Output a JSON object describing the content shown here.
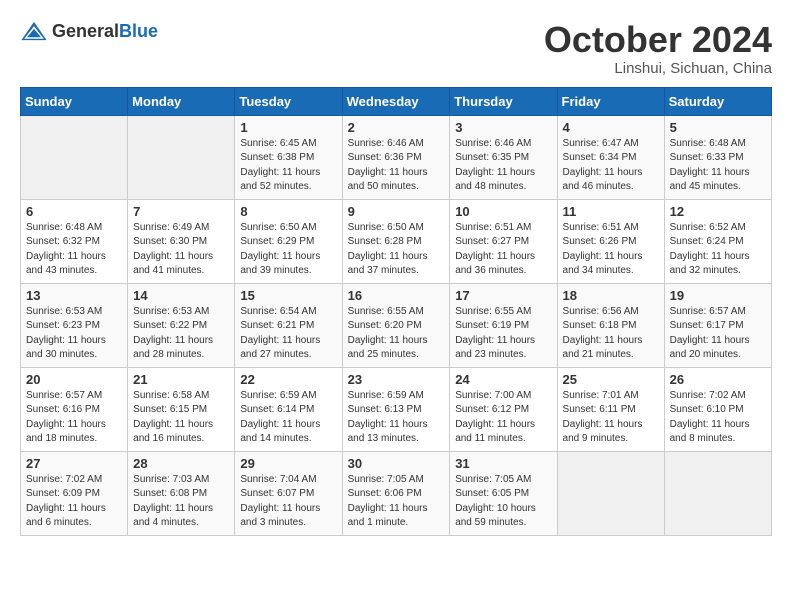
{
  "header": {
    "logo": {
      "text1": "General",
      "text2": "Blue"
    },
    "title": "October 2024",
    "subtitle": "Linshui, Sichuan, China"
  },
  "weekdays": [
    "Sunday",
    "Monday",
    "Tuesday",
    "Wednesday",
    "Thursday",
    "Friday",
    "Saturday"
  ],
  "weeks": [
    [
      {
        "day": "",
        "detail": ""
      },
      {
        "day": "",
        "detail": ""
      },
      {
        "day": "1",
        "detail": "Sunrise: 6:45 AM\nSunset: 6:38 PM\nDaylight: 11 hours\nand 52 minutes."
      },
      {
        "day": "2",
        "detail": "Sunrise: 6:46 AM\nSunset: 6:36 PM\nDaylight: 11 hours\nand 50 minutes."
      },
      {
        "day": "3",
        "detail": "Sunrise: 6:46 AM\nSunset: 6:35 PM\nDaylight: 11 hours\nand 48 minutes."
      },
      {
        "day": "4",
        "detail": "Sunrise: 6:47 AM\nSunset: 6:34 PM\nDaylight: 11 hours\nand 46 minutes."
      },
      {
        "day": "5",
        "detail": "Sunrise: 6:48 AM\nSunset: 6:33 PM\nDaylight: 11 hours\nand 45 minutes."
      }
    ],
    [
      {
        "day": "6",
        "detail": "Sunrise: 6:48 AM\nSunset: 6:32 PM\nDaylight: 11 hours\nand 43 minutes."
      },
      {
        "day": "7",
        "detail": "Sunrise: 6:49 AM\nSunset: 6:30 PM\nDaylight: 11 hours\nand 41 minutes."
      },
      {
        "day": "8",
        "detail": "Sunrise: 6:50 AM\nSunset: 6:29 PM\nDaylight: 11 hours\nand 39 minutes."
      },
      {
        "day": "9",
        "detail": "Sunrise: 6:50 AM\nSunset: 6:28 PM\nDaylight: 11 hours\nand 37 minutes."
      },
      {
        "day": "10",
        "detail": "Sunrise: 6:51 AM\nSunset: 6:27 PM\nDaylight: 11 hours\nand 36 minutes."
      },
      {
        "day": "11",
        "detail": "Sunrise: 6:51 AM\nSunset: 6:26 PM\nDaylight: 11 hours\nand 34 minutes."
      },
      {
        "day": "12",
        "detail": "Sunrise: 6:52 AM\nSunset: 6:24 PM\nDaylight: 11 hours\nand 32 minutes."
      }
    ],
    [
      {
        "day": "13",
        "detail": "Sunrise: 6:53 AM\nSunset: 6:23 PM\nDaylight: 11 hours\nand 30 minutes."
      },
      {
        "day": "14",
        "detail": "Sunrise: 6:53 AM\nSunset: 6:22 PM\nDaylight: 11 hours\nand 28 minutes."
      },
      {
        "day": "15",
        "detail": "Sunrise: 6:54 AM\nSunset: 6:21 PM\nDaylight: 11 hours\nand 27 minutes."
      },
      {
        "day": "16",
        "detail": "Sunrise: 6:55 AM\nSunset: 6:20 PM\nDaylight: 11 hours\nand 25 minutes."
      },
      {
        "day": "17",
        "detail": "Sunrise: 6:55 AM\nSunset: 6:19 PM\nDaylight: 11 hours\nand 23 minutes."
      },
      {
        "day": "18",
        "detail": "Sunrise: 6:56 AM\nSunset: 6:18 PM\nDaylight: 11 hours\nand 21 minutes."
      },
      {
        "day": "19",
        "detail": "Sunrise: 6:57 AM\nSunset: 6:17 PM\nDaylight: 11 hours\nand 20 minutes."
      }
    ],
    [
      {
        "day": "20",
        "detail": "Sunrise: 6:57 AM\nSunset: 6:16 PM\nDaylight: 11 hours\nand 18 minutes."
      },
      {
        "day": "21",
        "detail": "Sunrise: 6:58 AM\nSunset: 6:15 PM\nDaylight: 11 hours\nand 16 minutes."
      },
      {
        "day": "22",
        "detail": "Sunrise: 6:59 AM\nSunset: 6:14 PM\nDaylight: 11 hours\nand 14 minutes."
      },
      {
        "day": "23",
        "detail": "Sunrise: 6:59 AM\nSunset: 6:13 PM\nDaylight: 11 hours\nand 13 minutes."
      },
      {
        "day": "24",
        "detail": "Sunrise: 7:00 AM\nSunset: 6:12 PM\nDaylight: 11 hours\nand 11 minutes."
      },
      {
        "day": "25",
        "detail": "Sunrise: 7:01 AM\nSunset: 6:11 PM\nDaylight: 11 hours\nand 9 minutes."
      },
      {
        "day": "26",
        "detail": "Sunrise: 7:02 AM\nSunset: 6:10 PM\nDaylight: 11 hours\nand 8 minutes."
      }
    ],
    [
      {
        "day": "27",
        "detail": "Sunrise: 7:02 AM\nSunset: 6:09 PM\nDaylight: 11 hours\nand 6 minutes."
      },
      {
        "day": "28",
        "detail": "Sunrise: 7:03 AM\nSunset: 6:08 PM\nDaylight: 11 hours\nand 4 minutes."
      },
      {
        "day": "29",
        "detail": "Sunrise: 7:04 AM\nSunset: 6:07 PM\nDaylight: 11 hours\nand 3 minutes."
      },
      {
        "day": "30",
        "detail": "Sunrise: 7:05 AM\nSunset: 6:06 PM\nDaylight: 11 hours\nand 1 minute."
      },
      {
        "day": "31",
        "detail": "Sunrise: 7:05 AM\nSunset: 6:05 PM\nDaylight: 10 hours\nand 59 minutes."
      },
      {
        "day": "",
        "detail": ""
      },
      {
        "day": "",
        "detail": ""
      }
    ]
  ]
}
